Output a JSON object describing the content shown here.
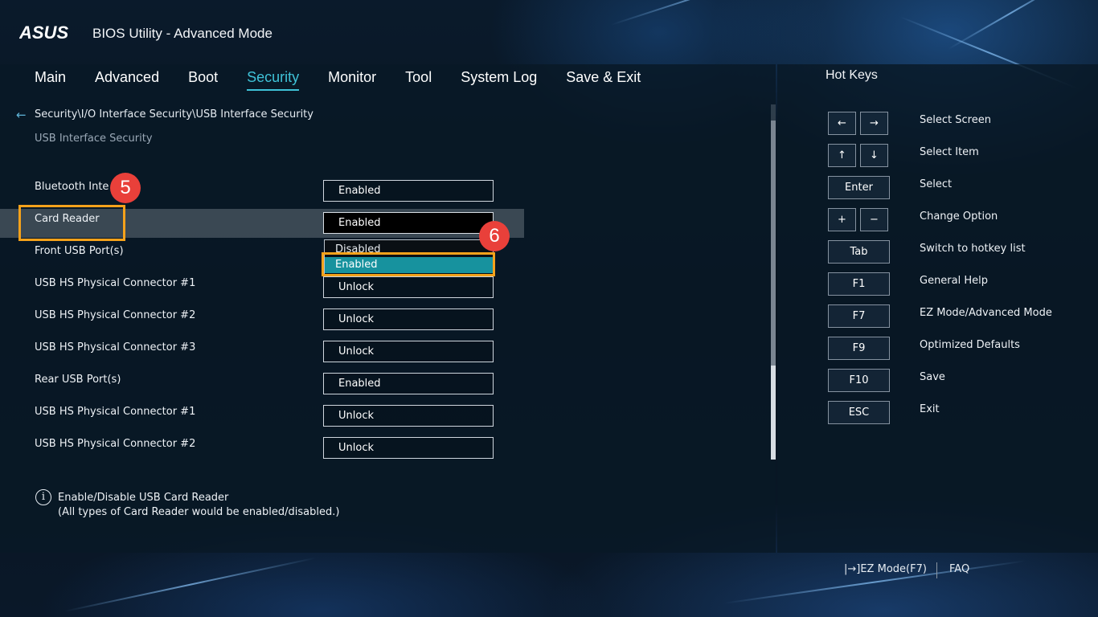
{
  "header": {
    "brand": "ASUS",
    "title": "BIOS Utility - Advanced Mode"
  },
  "nav": {
    "tabs": [
      {
        "label": "Main",
        "active": false
      },
      {
        "label": "Advanced",
        "active": false
      },
      {
        "label": "Boot",
        "active": false
      },
      {
        "label": "Security",
        "active": true
      },
      {
        "label": "Monitor",
        "active": false
      },
      {
        "label": "Tool",
        "active": false
      },
      {
        "label": "System Log",
        "active": false
      },
      {
        "label": "Save & Exit",
        "active": false
      }
    ]
  },
  "breadcrumb": "Security\\I/O Interface Security\\USB Interface Security",
  "page_subtitle": "USB Interface Security",
  "settings": [
    {
      "label": "Bluetooth Inte",
      "value": "Enabled"
    },
    {
      "label": "Card Reader",
      "value": "Enabled"
    },
    {
      "label": "Front USB Port(s)",
      "value": ""
    },
    {
      "label": "USB HS Physical Connector #1",
      "value": "Unlock"
    },
    {
      "label": "USB HS Physical Connector #2",
      "value": "Unlock"
    },
    {
      "label": "USB HS Physical Connector #3",
      "value": "Unlock"
    },
    {
      "label": "Rear USB Port(s)",
      "value": "Enabled"
    },
    {
      "label": "USB HS Physical Connector #1",
      "value": "Unlock"
    },
    {
      "label": "USB HS Physical Connector #2",
      "value": "Unlock"
    }
  ],
  "dropdown": {
    "options": [
      "Disabled",
      "Enabled"
    ],
    "highlighted": "Enabled"
  },
  "annotations": {
    "badge_5": "5",
    "badge_6": "6"
  },
  "help": {
    "line1": "Enable/Disable USB Card Reader",
    "line2": "(All types of Card Reader would be enabled/disabled.)"
  },
  "hotkeys": {
    "title": "Hot Keys",
    "items": [
      {
        "keys": [
          "←",
          "→"
        ],
        "desc": "Select Screen"
      },
      {
        "keys": [
          "↑",
          "↓"
        ],
        "desc": "Select Item"
      },
      {
        "keys": [
          "Enter"
        ],
        "desc": "Select"
      },
      {
        "keys": [
          "+",
          "−"
        ],
        "desc": "Change Option"
      },
      {
        "keys": [
          "Tab"
        ],
        "desc": "Switch to hotkey list"
      },
      {
        "keys": [
          "F1"
        ],
        "desc": "General Help"
      },
      {
        "keys": [
          "F7"
        ],
        "desc": "EZ Mode/Advanced Mode"
      },
      {
        "keys": [
          "F9"
        ],
        "desc": "Optimized Defaults"
      },
      {
        "keys": [
          "F10"
        ],
        "desc": "Save"
      },
      {
        "keys": [
          "ESC"
        ],
        "desc": "Exit"
      }
    ]
  },
  "footer": {
    "ez_mode": "|→]EZ Mode(F7)",
    "faq": "FAQ"
  },
  "colors": {
    "accent": "#3fc2d8",
    "annotation_border": "#f5a21b",
    "annotation_badge": "#e9403a",
    "dropdown_highlight": "#17929e"
  }
}
